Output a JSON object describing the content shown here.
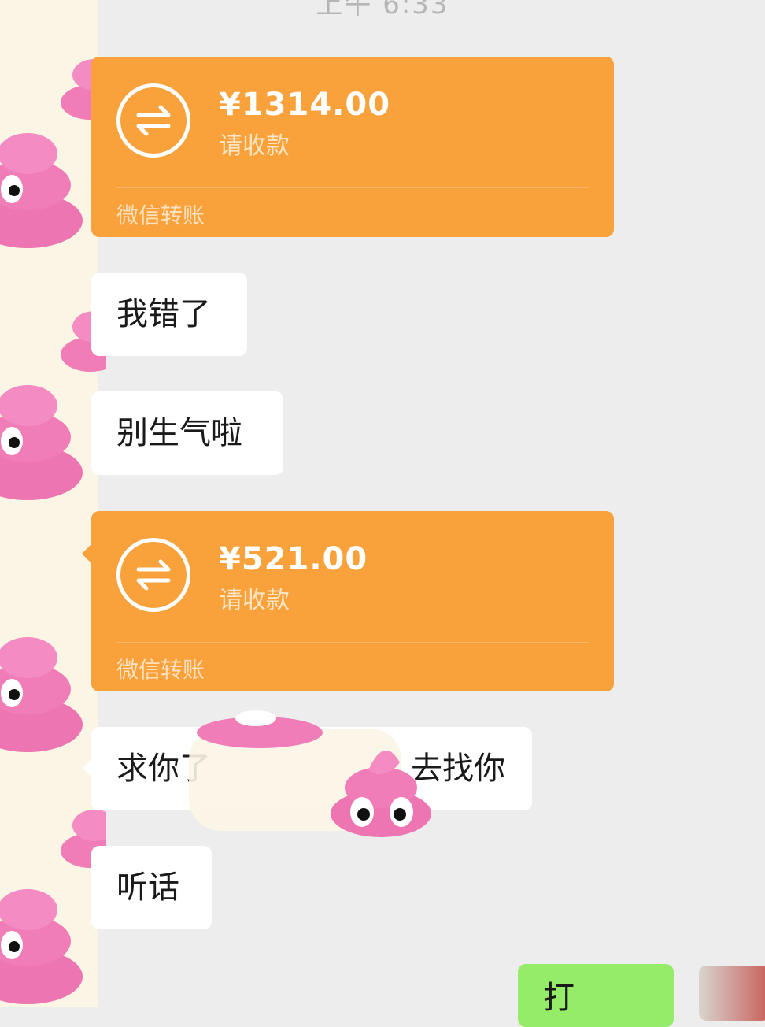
{
  "chat": {
    "timestamp": "上午 6:33",
    "messages": [
      {
        "type": "transfer",
        "amount": "¥1314.00",
        "subtitle": "请收款",
        "footer": "微信转账"
      },
      {
        "type": "text",
        "text": "我错了"
      },
      {
        "type": "text",
        "text": "别生气啦"
      },
      {
        "type": "transfer",
        "amount": "¥521.00",
        "subtitle": "请收款",
        "footer": "微信转账"
      },
      {
        "type": "text",
        "text": "求你了",
        "text_right": "去找你"
      },
      {
        "type": "text",
        "text": "听话"
      }
    ],
    "outgoing_partial": "打"
  },
  "colors": {
    "transfer_orange": "#f9a13a",
    "bubble_white": "#ffffff",
    "outgoing_green": "#95ec69",
    "background": "#ededed",
    "emoji_pink": "#f07db8"
  },
  "icons": [
    "transfer-arrows-icon",
    "poop-emoji-icon"
  ]
}
